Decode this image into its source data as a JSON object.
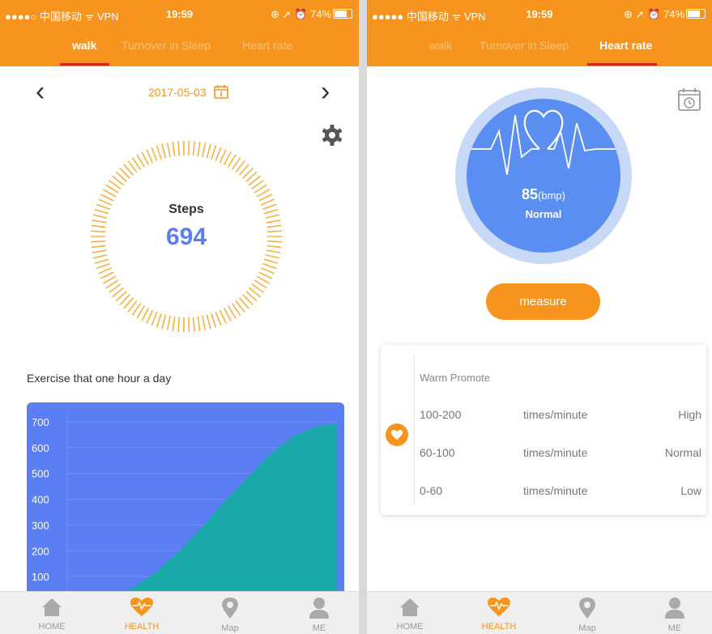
{
  "status_bar": {
    "left": {
      "carrier": "●●●●○ 中国移动 ᯤ VPN",
      "time": "19:59",
      "right": "⊕ ➚ ⏰ 74%"
    },
    "right": {
      "carrier": "●●●●● 中国移动 ᯤ VPN",
      "time": "19:59",
      "right": "⊕ ➚ ⏰ 74%"
    }
  },
  "tabs": [
    "walk",
    "Turnover in Sleep",
    "Heart rate"
  ],
  "walk": {
    "date": "2017-05-03",
    "steps_label": "Steps",
    "steps_value": "694",
    "exercise_title": "Exercise that one hour a day"
  },
  "chart_data": {
    "type": "area",
    "title": "",
    "xlabel": "",
    "ylabel": "",
    "y_ticks": [
      "700",
      "600",
      "500",
      "400",
      "300",
      "200",
      "100"
    ],
    "ylim": [
      0,
      700
    ],
    "x": [
      0,
      1,
      2,
      3,
      4,
      5,
      6,
      7,
      8,
      9,
      10,
      11,
      12
    ],
    "values": [
      0,
      5,
      20,
      60,
      120,
      200,
      290,
      390,
      480,
      570,
      640,
      680,
      694
    ],
    "colors": {
      "background": "#5b7ff3",
      "fill": "#1ba8a9",
      "grid": "#6f8ff5"
    },
    "grid": true
  },
  "heart": {
    "bpm_value": "85",
    "bpm_unit": "(bmp)",
    "state": "Normal",
    "measure_label": "measure",
    "promote_title": "Warm Promote",
    "rows": [
      {
        "range": "100-200",
        "unit": "times/minute",
        "level": "High"
      },
      {
        "range": "60-100",
        "unit": "times/minute",
        "level": "Normal"
      },
      {
        "range": "0-60",
        "unit": "times/minute",
        "level": "Low"
      }
    ]
  },
  "nav": [
    "HOME",
    "HEALTH",
    "Map",
    "ME"
  ],
  "colors": {
    "accent": "#f7941d",
    "blue": "#5b7ff3",
    "circle_blue": "#5a8ef0",
    "circle_ring": "#c8d9f8",
    "teal": "#1ba8a9"
  }
}
